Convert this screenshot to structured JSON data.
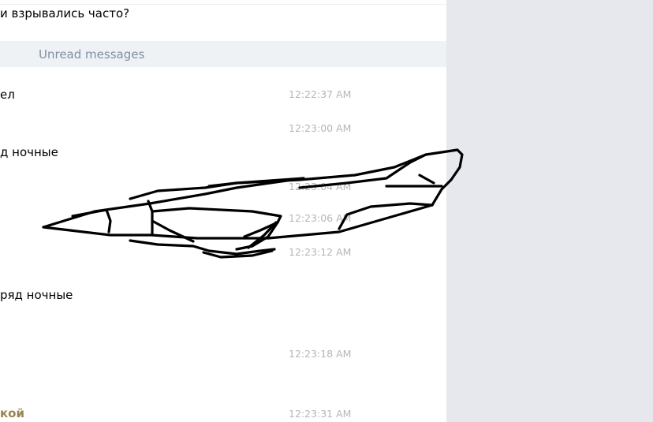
{
  "chat": {
    "messages": [
      {
        "text": "и взрывались часто?"
      },
      {
        "text": "ел",
        "time": "12:22:37 AM"
      },
      {
        "time": "12:23:00 AM"
      },
      {
        "text": "д ночные"
      },
      {
        "time": "12:23:04 AM"
      },
      {
        "time": "12:23:06 AM"
      },
      {
        "time": "12:23:12 AM"
      },
      {
        "text": "ряд ночные"
      },
      {
        "time": "12:23:18 AM"
      },
      {
        "sender": "кой",
        "time": "12:23:31 AM"
      }
    ],
    "unread_label": "Unread messages"
  },
  "drawing": {
    "description_icon": "hand-drawn-jet-sketch",
    "stroke_color": "#000000"
  },
  "colors": {
    "unread_bar": "#eff2f5",
    "unread_text": "#7d8fa2",
    "timestamp": "#b3b6bb",
    "sender_name": "#9a8550",
    "side_panel": "#e6e8ed"
  }
}
